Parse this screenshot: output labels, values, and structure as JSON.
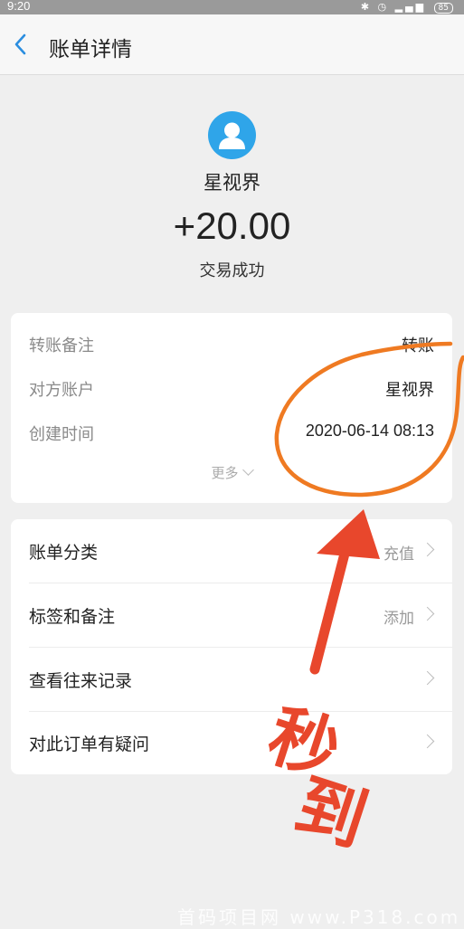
{
  "status_bar": {
    "time": "9:20",
    "battery": "85"
  },
  "nav": {
    "title": "账单详情"
  },
  "summary": {
    "payee": "星视界",
    "amount": "+20.00",
    "status": "交易成功"
  },
  "details": {
    "rows": [
      {
        "label": "转账备注",
        "value": "转账"
      },
      {
        "label": "对方账户",
        "value": "星视界"
      },
      {
        "label": "创建时间",
        "value": "2020-06-14 08:13"
      }
    ],
    "more_label": "更多"
  },
  "actions": [
    {
      "label": "账单分类",
      "value": "充值"
    },
    {
      "label": "标签和备注",
      "value": "添加"
    },
    {
      "label": "查看往来记录",
      "value": ""
    },
    {
      "label": "对此订单有疑问",
      "value": ""
    }
  ],
  "annotation": {
    "text_1": "秒",
    "text_2": "到",
    "color": "#e8472c",
    "circle_color": "#ef7a22"
  },
  "watermark": "首码项目网 www.P318.com"
}
